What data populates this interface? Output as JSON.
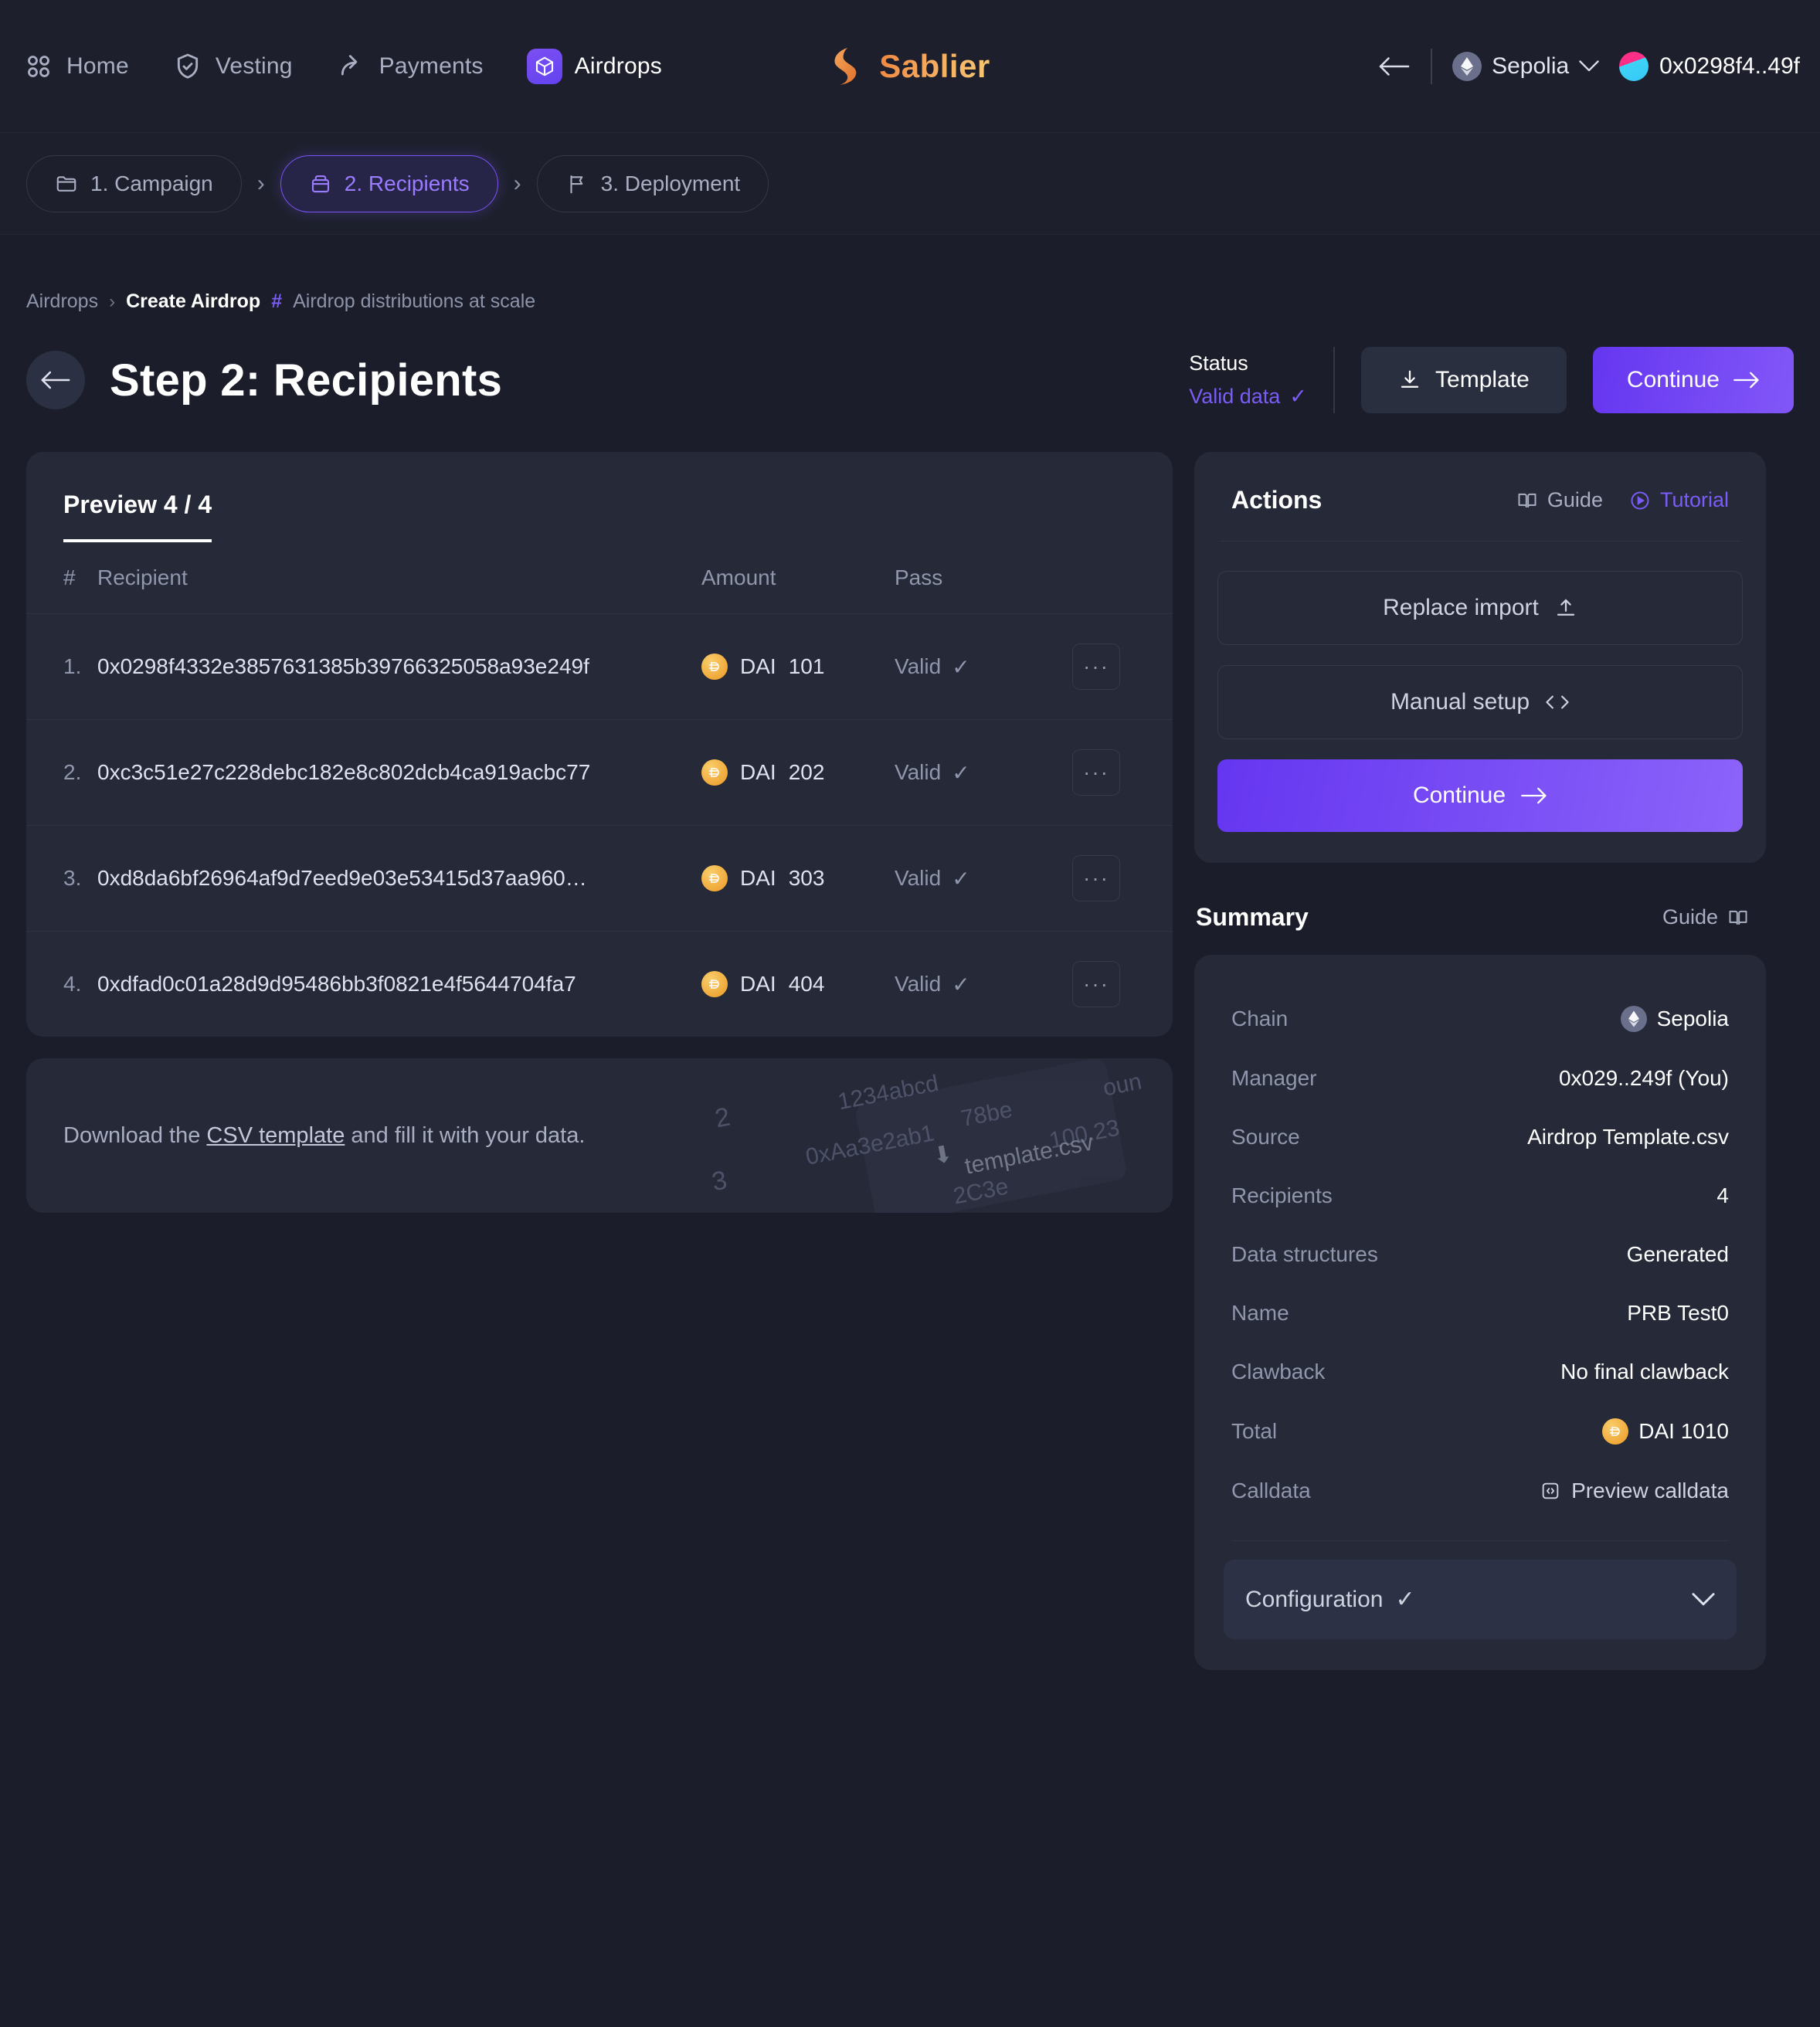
{
  "topnav": {
    "items": [
      {
        "label": "Home",
        "icon": "grid-icon",
        "active": false
      },
      {
        "label": "Vesting",
        "icon": "shield-check-icon",
        "active": false
      },
      {
        "label": "Payments",
        "icon": "share-arrow-icon",
        "active": false
      },
      {
        "label": "Airdrops",
        "icon": "cube-icon",
        "active": true
      }
    ],
    "brand": "Sablier",
    "back_icon": "arrow-left-icon",
    "chain": "Sepolia",
    "chain_icon": "ethereum-icon",
    "chain_caret": "chevron-down-icon",
    "wallet": "0x0298f4..49f"
  },
  "steps": [
    {
      "label": "1. Campaign",
      "icon": "folder-icon",
      "current": false
    },
    {
      "label": "2. Recipients",
      "icon": "package-icon",
      "current": true
    },
    {
      "label": "3. Deployment",
      "icon": "flag-icon",
      "current": false
    }
  ],
  "breadcrumb": {
    "root": "Airdrops",
    "separator": "›",
    "current": "Create Airdrop",
    "hash": "#",
    "description": "Airdrop distributions at scale"
  },
  "header": {
    "title": "Step 2: Recipients",
    "back_icon": "arrow-left-icon",
    "status_label": "Status",
    "status_value": "Valid data",
    "status_check": "✓",
    "template_button": "Template",
    "template_icon": "download-icon",
    "continue_button": "Continue",
    "continue_icon": "arrow-right-icon"
  },
  "preview": {
    "title": "Preview 4 / 4",
    "columns": [
      "#",
      "Recipient",
      "Amount",
      "Pass"
    ],
    "menu_glyph": "···",
    "rows": [
      {
        "index": "1.",
        "recipient": "0x0298f4332e3857631385b39766325058a93e249f",
        "token": "DAI",
        "amount": "101",
        "pass": "Valid",
        "pass_check": "✓"
      },
      {
        "index": "2.",
        "recipient": "0xc3c51e27c228debc182e8c802dcb4ca919acbc77",
        "token": "DAI",
        "amount": "202",
        "pass": "Valid",
        "pass_check": "✓"
      },
      {
        "index": "3.",
        "recipient": "0xd8da6bf26964af9d7eed9e03e53415d37aa960…",
        "token": "DAI",
        "amount": "303",
        "pass": "Valid",
        "pass_check": "✓"
      },
      {
        "index": "4.",
        "recipient": "0xdfad0c01a28d9d95486bb3f0821e4f5644704fa7",
        "token": "DAI",
        "amount": "404",
        "pass": "Valid",
        "pass_check": "✓"
      }
    ]
  },
  "csv_hint": {
    "before": "Download the ",
    "link": "CSV template",
    "after": " and fill it with your data.",
    "decor_filename": "template.csv",
    "decor_download_icon": "download-icon",
    "decor_rows": [
      "2",
      "3"
    ],
    "decor_fragments": [
      "1234abcd",
      "78be",
      "100.23",
      "0xAa3e2ab1",
      "2C3e",
      "oun"
    ]
  },
  "actions": {
    "title": "Actions",
    "guide_label": "Guide",
    "guide_icon": "book-icon",
    "tutorial_label": "Tutorial",
    "tutorial_icon": "play-circle-icon",
    "replace_import": "Replace import",
    "replace_import_icon": "upload-icon",
    "manual_setup": "Manual setup",
    "manual_setup_icon": "code-icon",
    "continue": "Continue",
    "continue_icon": "arrow-right-icon"
  },
  "summary": {
    "title": "Summary",
    "guide_label": "Guide",
    "guide_icon": "book-icon",
    "rows": [
      {
        "key": "Chain",
        "value": "Sepolia",
        "icon": "ethereum-icon"
      },
      {
        "key": "Manager",
        "value": "0x029..249f (You)",
        "icon": ""
      },
      {
        "key": "Source",
        "value": "Airdrop Template.csv",
        "icon": ""
      },
      {
        "key": "Recipients",
        "value": "4",
        "icon": ""
      },
      {
        "key": "Data structures",
        "value": "Generated",
        "icon": ""
      },
      {
        "key": "Name",
        "value": "PRB Test0",
        "icon": ""
      },
      {
        "key": "Clawback",
        "value": "No final clawback",
        "icon": ""
      },
      {
        "key": "Total",
        "value": "DAI 1010",
        "icon": "dai-coin-icon"
      },
      {
        "key": "Calldata",
        "value": "Preview calldata",
        "icon": "code-box-icon"
      }
    ],
    "configuration_label": "Configuration",
    "configuration_check": "✓",
    "configuration_caret": "chevron-down-icon"
  },
  "colors": {
    "accent": "#7a5cf6",
    "brand_orange": "#f0883e",
    "panel": "#252938",
    "background": "#1b1e2a",
    "dai": "#f0a93a"
  }
}
